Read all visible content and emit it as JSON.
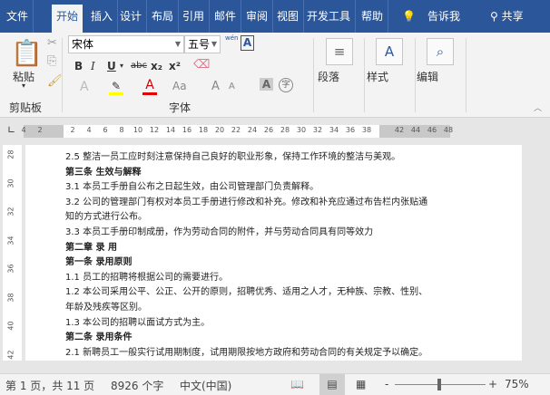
{
  "tabs": [
    "文件",
    "开始",
    "插入",
    "设计",
    "布局",
    "引用",
    "邮件",
    "审阅",
    "视图",
    "开发工具",
    "帮助"
  ],
  "tell_me": "告诉我",
  "share": "共享",
  "ribbon": {
    "paste": "粘贴",
    "clipboard": "剪贴板",
    "font_name": "宋体",
    "font_size": "五号",
    "font_group": "字体",
    "bold": "B",
    "italic": "I",
    "underline": "U",
    "strike": "abc",
    "sub": "x₂",
    "sup": "x²",
    "change_case": "Aa",
    "grow": "A",
    "shrink": "A",
    "char_shade": "A",
    "enclose": "字",
    "phonetic": "wén",
    "char_border": "A",
    "paragraph": "段落",
    "styles": "样式",
    "editing": "编辑"
  },
  "ruler_h": [
    "4",
    "2",
    "",
    "2",
    "4",
    "6",
    "8",
    "10",
    "12",
    "14",
    "16",
    "18",
    "20",
    "22",
    "24",
    "26",
    "28",
    "30",
    "32",
    "34",
    "36",
    "38",
    "",
    "42",
    "44",
    "46",
    "48"
  ],
  "ruler_v": [
    "28",
    "30",
    "32",
    "34",
    "36",
    "38",
    "40",
    "42"
  ],
  "document": {
    "lines": [
      {
        "text": "2.5  整洁一员工应时刻注意保持自己良好的职业形象，保持工作环境的整洁与美观。",
        "bold": false
      },
      {
        "text": "第三条   生效与解释",
        "bold": true
      },
      {
        "text": "3.1  本员工手册自公布之日起生效，由公司管理部门负责解释。",
        "bold": false
      },
      {
        "text": "3.2  公司的管理部门有权对本员工手册进行修改和补充。修改和补充应通过布告栏内张贴通",
        "bold": false
      },
      {
        "text": "知的方式进行公布。",
        "bold": false
      },
      {
        "text": "3.3  本员工手册印制成册，作为劳动合同的附件，并与劳动合同具有同等效力",
        "bold": false
      },
      {
        "text": "第二章   录   用",
        "bold": true
      },
      {
        "text": "第一条  录用原则",
        "bold": true
      },
      {
        "text": "1.1  员工的招聘将根据公司的需要进行。",
        "bold": false
      },
      {
        "text": "1.2  本公司采用公平、公正、公开的原则，招聘优秀、适用之人才，无种族、宗教、性别、",
        "bold": false
      },
      {
        "text": "年龄及残疾等区别。",
        "bold": false
      },
      {
        "text": "1.3  本公司的招聘以面试方式为主。",
        "bold": false
      },
      {
        "text": "第二条  录用条件",
        "bold": true
      },
      {
        "text": "2.1    新聘员工一般实行试用期制度，试用期限按地方政府和劳动合同的有关规定予以确定。",
        "bold": false
      }
    ]
  },
  "status": {
    "page": "第 1 页，共 11 页",
    "words": "8926 个字",
    "language": "中文(中国)",
    "zoom": "75%",
    "zoom_minus": "-",
    "zoom_plus": "+"
  },
  "colors": {
    "accent": "#2b579a",
    "highlight": "#ffff00",
    "font_color": "#e00000"
  }
}
